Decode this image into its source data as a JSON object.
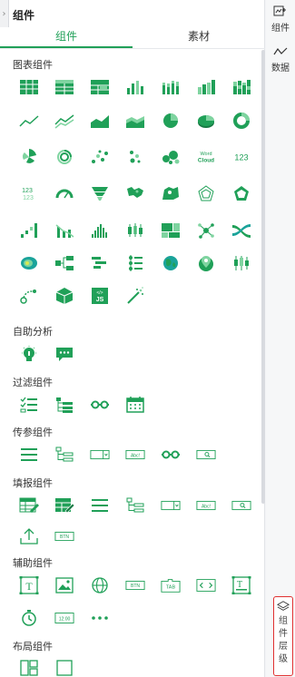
{
  "header": {
    "title": "组件"
  },
  "tabs": [
    {
      "label": "组件",
      "active": true
    },
    {
      "label": "素材",
      "active": false
    }
  ],
  "sections": {
    "chart": "图表组件",
    "assist_analysis": "自助分析",
    "filter": "过滤组件",
    "param": "传参组件",
    "form": "填报组件",
    "helper": "辅助组件",
    "layout": "布局组件"
  },
  "icon_text": {
    "wordcloud_1": "Word",
    "wordcloud_2": "Cloud",
    "number": "123",
    "number_small": "123",
    "js": "JS",
    "btn": "BTN",
    "abc": "Abc!",
    "tab": "TAB",
    "time": "12:00",
    "text_t": "T"
  },
  "right_bar": {
    "components": "组件",
    "data": "数据",
    "layers_chars": [
      "组",
      "件",
      "层",
      "级"
    ]
  },
  "colors": {
    "accent": "#20a058",
    "light": "#7fd4a0",
    "teal": "#1aa39a",
    "border_red": "#e03030"
  }
}
